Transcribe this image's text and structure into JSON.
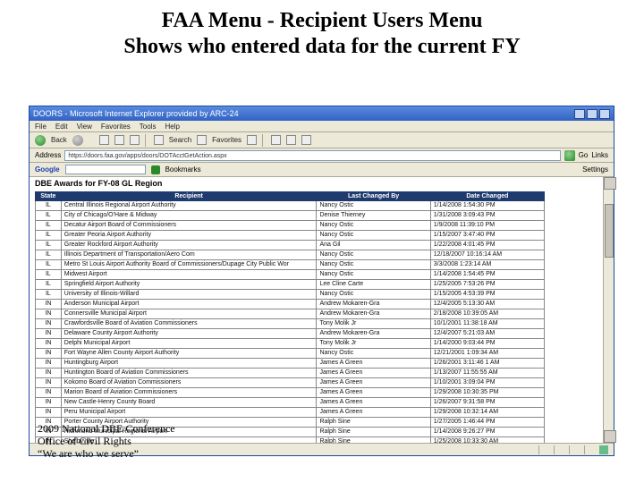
{
  "slide": {
    "title1": "FAA Menu - Recipient Users Menu",
    "title2": "Shows who entered data for the current FY"
  },
  "browser": {
    "title": "DOORS - Microsoft Internet Explorer provided by ARC-24",
    "menus": [
      "File",
      "Edit",
      "View",
      "Favorites",
      "Tools",
      "Help"
    ],
    "toolbar": {
      "back": "Back",
      "search": "Search",
      "favorites": "Favorites"
    },
    "address_label": "Address",
    "address": "https://doors.faa.gov/apps/doors/DOTAcctGetAction.aspx",
    "go": "Go",
    "links": "Links",
    "google": "Google",
    "bookmarks": "Bookmarks",
    "settings": "Settings"
  },
  "page": {
    "header": "DBE Awards for FY-08 GL Region",
    "columns": {
      "state": "State",
      "recipient": "Recipient",
      "by": "Last Changed By",
      "date": "Date Changed"
    },
    "rows": [
      {
        "state": "IL",
        "recipient": "Central Illinois Regional Airport Authority",
        "by": "Nancy Ostic",
        "date": "1/14/2008 1:54:30 PM"
      },
      {
        "state": "IL",
        "recipient": "City of Chicago/O'Hare & Midway",
        "by": "Denise Thierney",
        "date": "1/31/2008 3:09:43 PM"
      },
      {
        "state": "IL",
        "recipient": "Decatur Airport Board of Commissioners",
        "by": "Nancy Ostic",
        "date": "1/9/2008 11:39:10 PM"
      },
      {
        "state": "IL",
        "recipient": "Greater Peoria Airport Authority",
        "by": "Nancy Ostic",
        "date": "1/15/2007 3:47:40 PM"
      },
      {
        "state": "IL",
        "recipient": "Greater Rockford Airport Authority",
        "by": "Ana Gil",
        "date": "1/22/2008 4:01:45 PM"
      },
      {
        "state": "IL",
        "recipient": "Illinois Department of Transportation/Aero Com",
        "by": "Nancy Ostic",
        "date": "12/18/2007 10:16:14 AM"
      },
      {
        "state": "IL",
        "recipient": "Metro St Louis Airport Authority Board of Commissioners/Dupage City Public Wor",
        "by": "Nancy Ostic",
        "date": "3/3/2008 1:23:14 AM"
      },
      {
        "state": "IL",
        "recipient": "Midwest Airport",
        "by": "Nancy Ostic",
        "date": "1/14/2008 1:54:45 PM"
      },
      {
        "state": "IL",
        "recipient": "Springfield Airport Authority",
        "by": "Lee Cline Carte",
        "date": "1/25/2005 7:53:26 PM"
      },
      {
        "state": "IL",
        "recipient": "University of Illinois-Willard",
        "by": "Nancy Ostic",
        "date": "1/15/2005 4:53:39 PM"
      },
      {
        "state": "IN",
        "recipient": "Anderson Municipal Airport",
        "by": "Andrew Mokaren-Gra",
        "date": "12/4/2005 5:13:30 AM"
      },
      {
        "state": "IN",
        "recipient": "Connersville Municipal Airport",
        "by": "Andrew Mokaren-Gra",
        "date": "2/18/2008 10:39:05 AM"
      },
      {
        "state": "IN",
        "recipient": "Crawfordsville Board of Aviation Commissioners",
        "by": "Tony Molik Jr",
        "date": "10/1/2001 11:38:18 AM"
      },
      {
        "state": "IN",
        "recipient": "Delaware County Airport Authority",
        "by": "Andrew Mokaren-Gra",
        "date": "12/4/2007 5:21:03 AM"
      },
      {
        "state": "IN",
        "recipient": "Delphi Municipal Airport",
        "by": "Tony Molik Jr",
        "date": "1/14/2000 9:03:44 PM"
      },
      {
        "state": "IN",
        "recipient": "Fort Wayne Allen County Airport Authority",
        "by": "Nancy Ostic",
        "date": "12/21/2001 1:09:34 AM"
      },
      {
        "state": "IN",
        "recipient": "Huntingburg Airport",
        "by": "James A Green",
        "date": "1/26/2001 3:11:46 1 AM"
      },
      {
        "state": "IN",
        "recipient": "Huntington Board of Aviation Commissioners",
        "by": "James A Green",
        "date": "1/13/2007 11:55:55 AM"
      },
      {
        "state": "IN",
        "recipient": "Kokomo Board of Aviation Commissioners",
        "by": "James A Green",
        "date": "1/10/2001 3:09:04 PM"
      },
      {
        "state": "IN",
        "recipient": "Marion Board of Aviation Commissioners",
        "by": "James A Green",
        "date": "1/29/2008 10:30:35 PM"
      },
      {
        "state": "IN",
        "recipient": "New Castle-Henry County Board",
        "by": "James A Green",
        "date": "1/26/2007 9:31:58 PM"
      },
      {
        "state": "IN",
        "recipient": "Peru Municipal Airport",
        "by": "James A Green",
        "date": "1/29/2008 10:32:14 AM"
      },
      {
        "state": "IN",
        "recipient": "Porter County Airport Authority",
        "by": "Ralph Sine",
        "date": "1/27/2005 1:46:44 PM"
      },
      {
        "state": "IN",
        "recipient": "Richmond Municipal Regional Airport",
        "by": "Ralph Sine",
        "date": "1/14/2008 9:26:27 PM"
      },
      {
        "state": "IN",
        "recipient": "Shelbyville",
        "by": "Ralph Sine",
        "date": "1/25/2008 10:33:30 AM"
      }
    ]
  },
  "footer": {
    "line1": "2009 National DBE Conference",
    "line2": "Office of Civil Rights",
    "line3": "“We are who we serve”"
  }
}
